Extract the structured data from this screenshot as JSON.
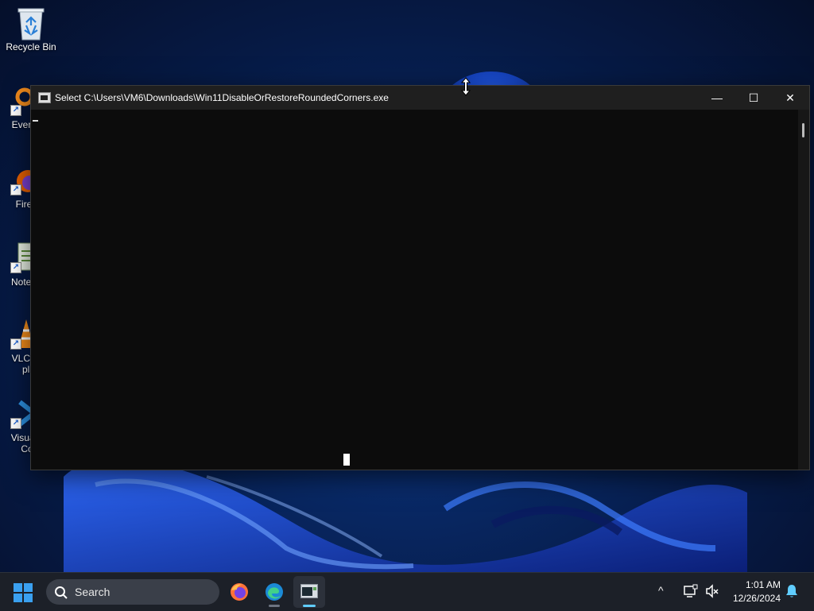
{
  "desktop": {
    "icons": [
      {
        "label": "Recycle Bin"
      },
      {
        "label": "Every"
      },
      {
        "label": "Fire"
      },
      {
        "label": "Notep"
      },
      {
        "label": "VLC r",
        "label2": "pla"
      },
      {
        "label": "Visual",
        "label2": "Co"
      }
    ]
  },
  "console": {
    "title": "Select C:\\Users\\VM6\\Downloads\\Win11DisableOrRestoreRoundedCorners.exe",
    "minimize_glyph": "—",
    "maximize_glyph": "☐",
    "close_glyph": "✕"
  },
  "taskbar": {
    "search_placeholder": "Search",
    "tray_chevron": "^",
    "clock_time": "1:01 AM",
    "clock_date": "12/26/2024"
  },
  "colors": {
    "accent": "#60cdff",
    "taskbar": "#1c2028",
    "console_bg": "#0c0c0c",
    "titlebar": "#1f1f1f"
  },
  "icons": [
    "recycle-bin-icon",
    "search-icon",
    "windows-start-icon",
    "firefox-icon",
    "edge-icon",
    "console-icon",
    "network-icon",
    "sound-muted-icon",
    "notification-bell-icon"
  ]
}
